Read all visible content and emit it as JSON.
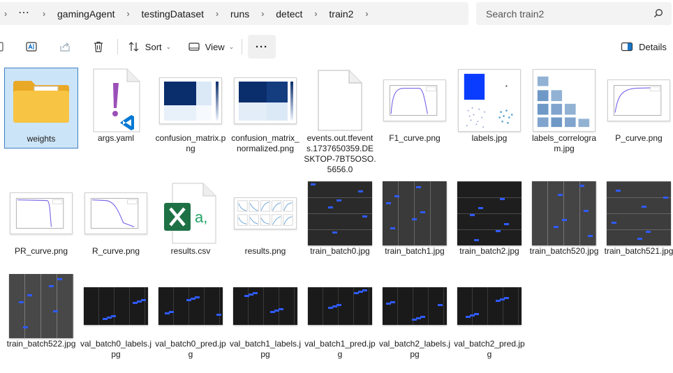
{
  "address": {
    "more_glyph": "⋯",
    "crumbs": [
      "gamingAgent",
      "testingDataset",
      "runs",
      "detect",
      "train2"
    ]
  },
  "search": {
    "placeholder": "Search train2"
  },
  "toolbar": {
    "sort_label": "Sort",
    "view_label": "View",
    "more_glyph": "···",
    "details_label": "Details"
  },
  "files": [
    {
      "name": "weights",
      "kind": "folder",
      "selected": true
    },
    {
      "name": "args.yaml",
      "kind": "yaml"
    },
    {
      "name": "confusion_matrix.png",
      "kind": "matrix"
    },
    {
      "name": "confusion_matrix_normalized.png",
      "kind": "matrix"
    },
    {
      "name": "events.out.tfevents.1737650359.DESKTOP-7BT5OSO.5656.0",
      "kind": "blank"
    },
    {
      "name": "F1_curve.png",
      "kind": "curve"
    },
    {
      "name": "labels.jpg",
      "kind": "labels"
    },
    {
      "name": "labels_correlogram.jpg",
      "kind": "correlogram"
    },
    {
      "name": "P_curve.png",
      "kind": "curve"
    },
    {
      "name": "PR_curve.png",
      "kind": "curve"
    },
    {
      "name": "R_curve.png",
      "kind": "curve"
    },
    {
      "name": "results.csv",
      "kind": "excel"
    },
    {
      "name": "results.png",
      "kind": "results"
    },
    {
      "name": "train_batch0.jpg",
      "kind": "mosaic"
    },
    {
      "name": "train_batch1.jpg",
      "kind": "mosaic"
    },
    {
      "name": "train_batch2.jpg",
      "kind": "mosaic"
    },
    {
      "name": "train_batch520.jpg",
      "kind": "mosaic"
    },
    {
      "name": "train_batch521.jpg",
      "kind": "mosaic"
    },
    {
      "name": "train_batch522.jpg",
      "kind": "mosaic"
    },
    {
      "name": "val_batch0_labels.jpg",
      "kind": "val"
    },
    {
      "name": "val_batch0_pred.jpg",
      "kind": "val"
    },
    {
      "name": "val_batch1_labels.jpg",
      "kind": "val"
    },
    {
      "name": "val_batch1_pred.jpg",
      "kind": "val"
    },
    {
      "name": "val_batch2_labels.jpg",
      "kind": "val"
    },
    {
      "name": "val_batch2_pred.jpg",
      "kind": "val"
    }
  ],
  "colors": {
    "selection": "#cce4f7",
    "accent": "#0067c0",
    "folder": "#f7c443",
    "excel": "#1e7145",
    "curve": "#7b6be8"
  }
}
